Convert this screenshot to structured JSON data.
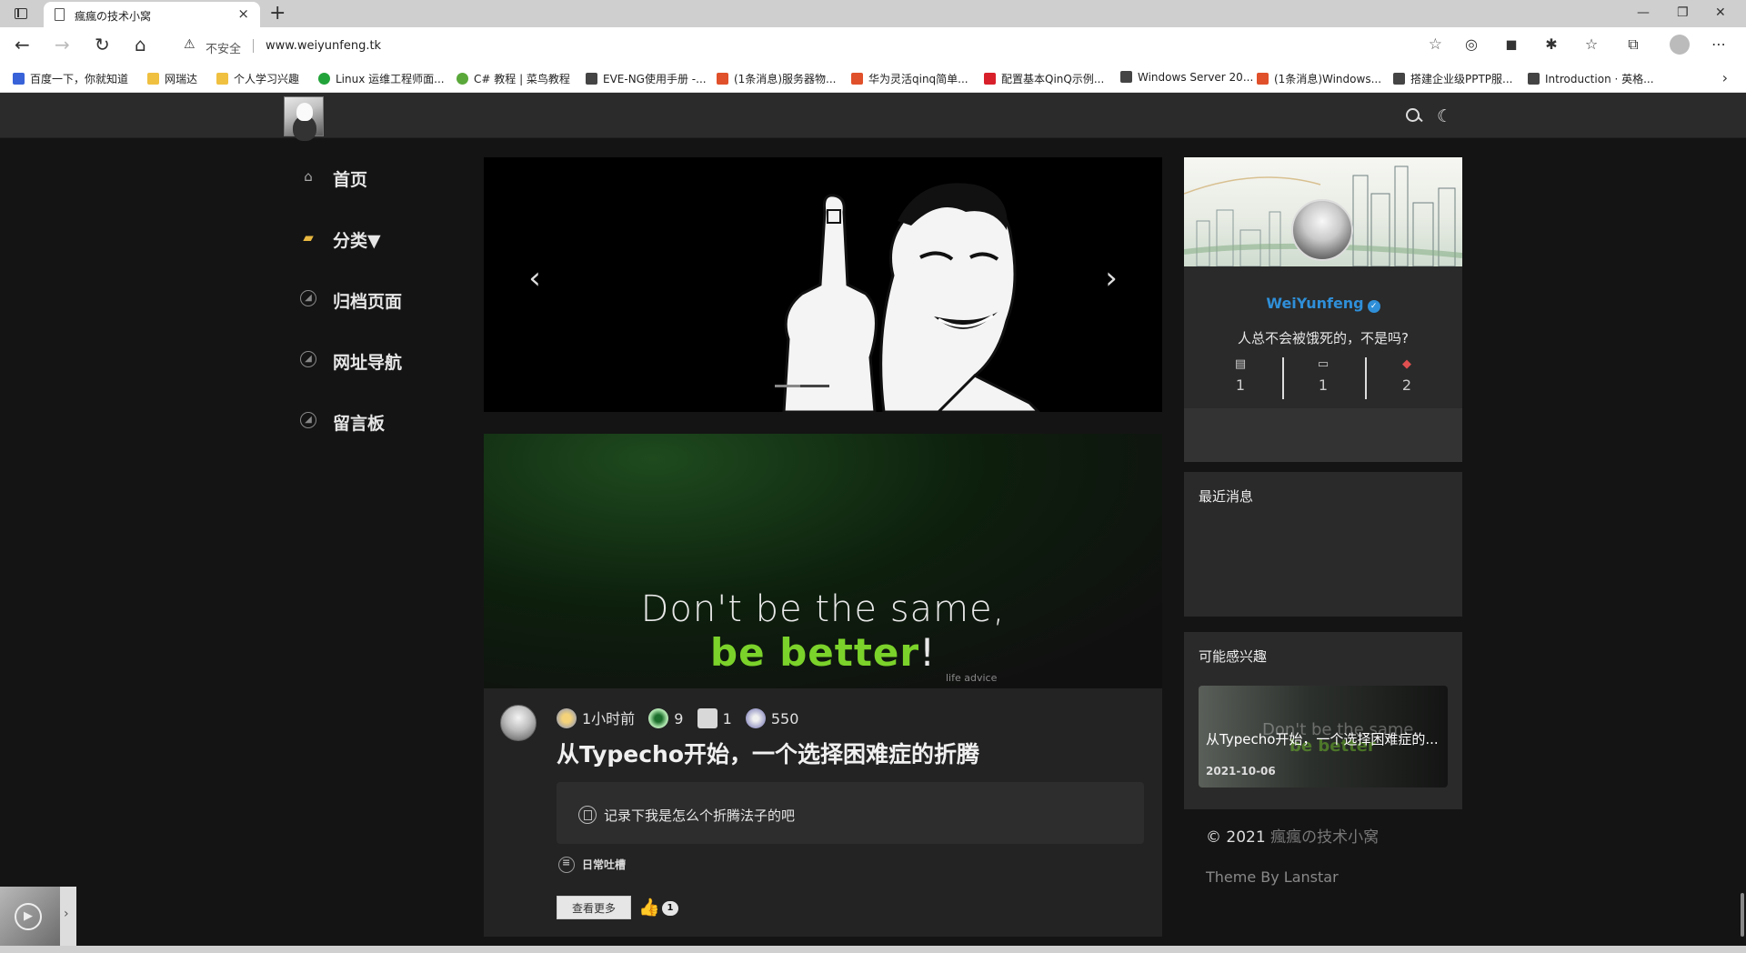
{
  "browser": {
    "tab_title": "瘋瘋の技术小窝",
    "insecure_label": "不安全",
    "url": "www.weiyunfeng.tk",
    "bookmarks": [
      {
        "label": "百度一下，你就知道",
        "color": "#3862d8"
      },
      {
        "label": "网瑞达",
        "color": "#f0c040"
      },
      {
        "label": "个人学习兴趣",
        "color": "#f0c040"
      },
      {
        "label": "Linux 运维工程师面...",
        "color": "#22a33a"
      },
      {
        "label": "C# 教程 | 菜鸟教程",
        "color": "#5aa83a"
      },
      {
        "label": "EVE-NG使用手册 -...",
        "color": "#444444"
      },
      {
        "label": "(1条消息)服务器物...",
        "color": "#e0502a"
      },
      {
        "label": "华为灵活qinq简单...",
        "color": "#e0502a"
      },
      {
        "label": "配置基本QinQ示例...",
        "color": "#d8202a"
      },
      {
        "label": "Windows Server 20...",
        "color": "#444444"
      },
      {
        "label": "(1条消息)Windows...",
        "color": "#e0502a"
      },
      {
        "label": "搭建企业级PPTP服...",
        "color": "#444444"
      },
      {
        "label": "Introduction · 英格...",
        "color": "#444444"
      }
    ]
  },
  "site": {
    "nav": [
      {
        "label": "首页",
        "icon": "home-icon"
      },
      {
        "label": "分类▼",
        "icon": "folder-icon"
      },
      {
        "label": "归档页面",
        "icon": "compass-icon"
      },
      {
        "label": "网址导航",
        "icon": "compass-icon"
      },
      {
        "label": "留言板",
        "icon": "compass-icon"
      }
    ],
    "post": {
      "cover_line1": "Don't be the same,",
      "cover_line2_green": "be better",
      "cover_line2_tail": "!",
      "cover_caption": "life advice",
      "time": "1小时前",
      "views": "9",
      "comments": "1",
      "words": "550",
      "title": "从Typecho开始，一个选择困难症的折腾",
      "excerpt": "记录下我是怎么个折腾法子的吧",
      "category": "日常吐槽",
      "more_label": "查看更多",
      "likes": "1"
    },
    "profile": {
      "name": "WeiYunfeng",
      "motto": "人总不会被饿死的，不是吗?",
      "stats": [
        {
          "value": "1",
          "icon": "document-icon"
        },
        {
          "value": "1",
          "icon": "comment-icon"
        },
        {
          "value": "2",
          "icon": "tag-icon"
        }
      ]
    },
    "recent_title": "最近消息",
    "interest_title": "可能感兴趣",
    "interest_item": {
      "title": "从Typecho开始，一个选择困难症的...",
      "date": "2021-10-06",
      "ghost1": "Don't be the same,",
      "ghost2": "be better"
    },
    "footer": {
      "copyright_prefix": "© 2021",
      "site_name": "瘋瘋の技术小窝",
      "theme": "Theme By Lanstar"
    }
  },
  "colors": {
    "accent_blue": "#2f8fd8",
    "accent_green": "#7bd22a",
    "bg": "#141414",
    "card": "#232323"
  }
}
